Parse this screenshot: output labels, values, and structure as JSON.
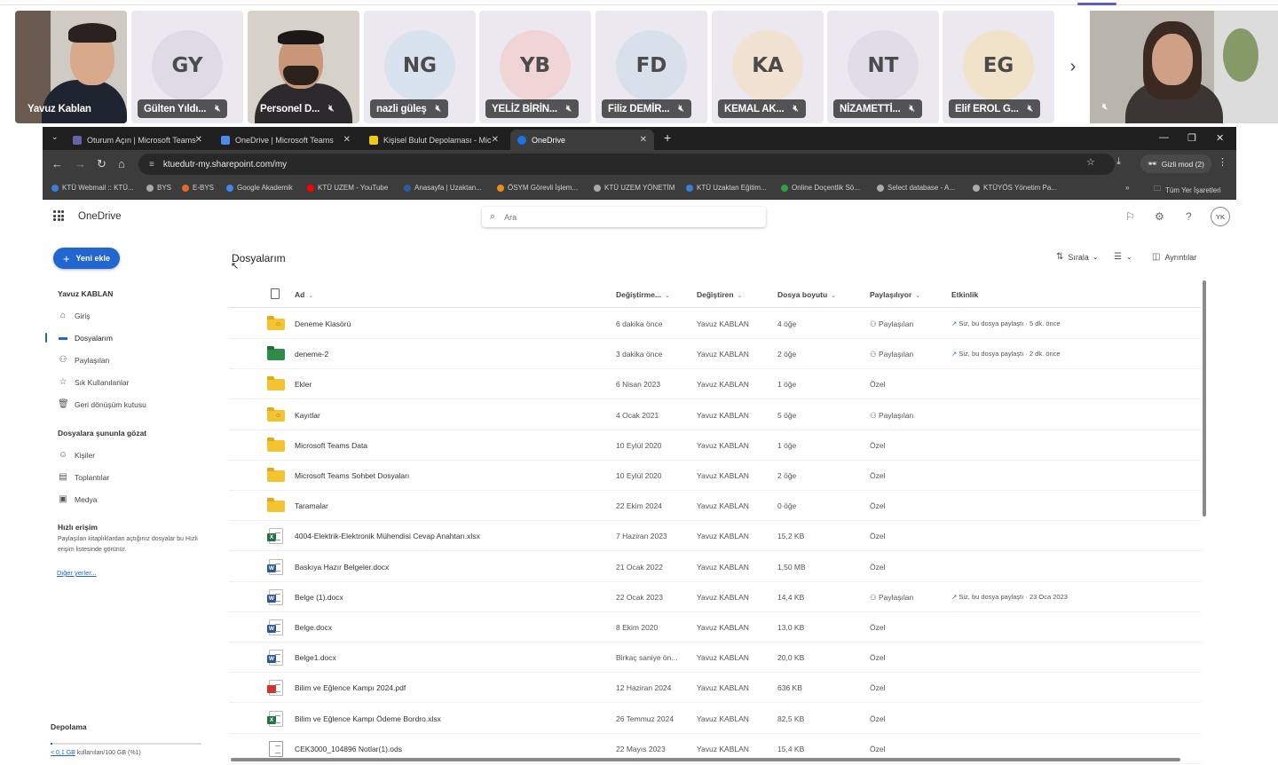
{
  "meeting": {
    "participants": [
      {
        "name": "Yavuz Kablan",
        "initials": "",
        "avatar_color": "",
        "video": true
      },
      {
        "name": "Gülten Yıldı...",
        "initials": "GY",
        "avatar_color": "#dedbe4",
        "video": false
      },
      {
        "name": "Personel D...",
        "initials": "",
        "avatar_color": "",
        "video": true
      },
      {
        "name": "nazli güleş",
        "initials": "NG",
        "avatar_color": "#d9e2ef",
        "video": false
      },
      {
        "name": "YELİZ BİRİN...",
        "initials": "YB",
        "avatar_color": "#f0d4d6",
        "video": false
      },
      {
        "name": "Filiz DEMİR...",
        "initials": "FD",
        "avatar_color": "#d8e0ec",
        "video": false
      },
      {
        "name": "KEMAL AK...",
        "initials": "KA",
        "avatar_color": "#f1e2d2",
        "video": false
      },
      {
        "name": "NİZAMETTİ...",
        "initials": "NT",
        "avatar_color": "#e0dce8",
        "video": false
      },
      {
        "name": "Elif EROL G...",
        "initials": "EG",
        "avatar_color": "#f1e3c9",
        "video": false
      }
    ],
    "next_icon": "chevron-right-icon",
    "mic_icon": "mic-off-icon"
  },
  "browser": {
    "tabs": [
      {
        "title": "Oturum Açın | Microsoft Teams",
        "favicon_color": "#6264a7",
        "active": false
      },
      {
        "title": "OneDrive | Microsoft Teams",
        "favicon_color": "#4b8be8",
        "active": false
      },
      {
        "title": "Kişisel Bulut Depolaması - Mic",
        "favicon_color": "#f2c811",
        "active": false
      },
      {
        "title": "OneDrive",
        "favicon_color": "#1a73e8",
        "active": true
      }
    ],
    "new_tab": "+",
    "window_controls": [
      "—",
      "❐",
      "✕"
    ],
    "url": "ktuedutr-my.sharepoint.com/my",
    "profile_label": "Gizli mod (2)",
    "bookmarks": [
      {
        "label": "KTÜ Webmail :: KTÜ...",
        "color": "#3b7ddd"
      },
      {
        "label": "BYS",
        "color": "#aaaaaa"
      },
      {
        "label": "E-BYS",
        "color": "#e06a2a"
      },
      {
        "label": "Google Akademik",
        "color": "#4285f4"
      },
      {
        "label": "KTÜ UZEM - YouTube",
        "color": "#ff0000"
      },
      {
        "label": "Anasayfa | Uzaktan...",
        "color": "#2a5caa"
      },
      {
        "label": "ÖSYM Görevli İşlem...",
        "color": "#f08a1c"
      },
      {
        "label": "KTÜ UZEM YÖNETİM",
        "color": "#aaaaaa"
      },
      {
        "label": "KTÜ Uzaktan Eğitim...",
        "color": "#3b7ddd"
      },
      {
        "label": "Online Doçentlik Sö...",
        "color": "#2ea043"
      },
      {
        "label": "Select database - A...",
        "color": "#aaaaaa"
      },
      {
        "label": "KTÜYÖS Yönetim Pa...",
        "color": "#aaaaaa"
      }
    ],
    "bookmarks_more": "»",
    "all_bookmarks": "Tüm Yer İşaretleri"
  },
  "app": {
    "name": "OneDrive",
    "search_placeholder": "Ara",
    "user_initials": "YK",
    "new_button": "Yeni ekle",
    "user_name": "Yavuz KABLAN",
    "nav": [
      {
        "label": "Giriş",
        "icon": "home-icon",
        "selected": false
      },
      {
        "label": "Dosyalarım",
        "icon": "folder-icon",
        "selected": true
      },
      {
        "label": "Paylaşılan",
        "icon": "people-icon",
        "selected": false
      },
      {
        "label": "Sık Kullanılanlar",
        "icon": "star-icon",
        "selected": false
      },
      {
        "label": "Geri dönüşüm kutusu",
        "icon": "trash-icon",
        "selected": false
      }
    ],
    "browse_heading": "Dosyalara şununla gözat",
    "browse": [
      {
        "label": "Kişiler",
        "icon": "person-icon"
      },
      {
        "label": "Toplantılar",
        "icon": "calendar-icon"
      },
      {
        "label": "Medya",
        "icon": "image-icon"
      }
    ],
    "quick_access_heading": "Hızlı erişim",
    "quick_access_note": "Paylaşılan kitaplıklardan açtığınız dosyalar bu Hızlı erişim listesinde görünür.",
    "more_places": "Diğer yerler...",
    "storage_heading": "Depolama",
    "storage_used": "< 0,1 GB",
    "storage_rest": "kullanılan/100 GB (%1)",
    "storage_fraction": 0.01
  },
  "files": {
    "title": "Dosyalarım",
    "sort_label": "Sırala",
    "details_label": "Ayrıntılar",
    "columns": {
      "name": "Ad",
      "modified": "Değiştirme...",
      "modified_by": "Değiştiren",
      "size": "Dosya boyutu",
      "sharing": "Paylaşılıyor",
      "activity": "Etkinlik"
    },
    "rows": [
      {
        "type": "folder-shared",
        "name": "Deneme Klasörü",
        "modified": "6 dakika önce",
        "by": "Yavuz KABLAN",
        "size": "4 öğe",
        "sharing": "Paylaşılan",
        "activity": "Siz, bu dosya paylaştı · 5 dk. önce"
      },
      {
        "type": "folder-green",
        "name": "deneme-2",
        "modified": "3 dakika önce",
        "by": "Yavuz KABLAN",
        "size": "2 öğe",
        "sharing": "Paylaşılan",
        "activity": "Siz, bu dosya paylaştı · 2 dk. önce"
      },
      {
        "type": "folder",
        "name": "Ekler",
        "modified": "6 Nisan 2023",
        "by": "Yavuz KABLAN",
        "size": "1 öğe",
        "sharing": "Özel",
        "activity": ""
      },
      {
        "type": "folder-shared",
        "name": "Kayıtlar",
        "modified": "4 Ocak 2021",
        "by": "Yavuz KABLAN",
        "size": "5 öğe",
        "sharing": "Paylaşılan",
        "activity": ""
      },
      {
        "type": "folder",
        "name": "Microsoft Teams Data",
        "modified": "10 Eylül 2020",
        "by": "Yavuz KABLAN",
        "size": "1 öğe",
        "sharing": "Özel",
        "activity": ""
      },
      {
        "type": "folder",
        "name": "Microsoft Teams Sohbet Dosyaları",
        "modified": "10 Eylül 2020",
        "by": "Yavuz KABLAN",
        "size": "2 öğe",
        "sharing": "Özel",
        "activity": ""
      },
      {
        "type": "folder",
        "name": "Taramalar",
        "modified": "22 Ekim 2024",
        "by": "Yavuz KABLAN",
        "size": "0 öğe",
        "sharing": "Özel",
        "activity": ""
      },
      {
        "type": "xlsx",
        "name": "4004-Elektrik-Elektronik Mühendisi Cevap Anahtarı.xlsx",
        "modified": "7 Haziran 2023",
        "by": "Yavuz KABLAN",
        "size": "15,2 KB",
        "sharing": "Özel",
        "activity": ""
      },
      {
        "type": "docx",
        "name": "Baskıya Hazır Belgeler.docx",
        "modified": "21 Ocak 2022",
        "by": "Yavuz KABLAN",
        "size": "1,50 MB",
        "sharing": "Özel",
        "activity": ""
      },
      {
        "type": "docx",
        "name": "Belge (1).docx",
        "modified": "22 Ocak 2023",
        "by": "Yavuz KABLAN",
        "size": "14,4 KB",
        "sharing": "Paylaşılan",
        "activity": "Siz, bu dosya paylaştı · 23 Oca 2023"
      },
      {
        "type": "docx",
        "name": "Belge.docx",
        "modified": "8 Ekim 2020",
        "by": "Yavuz KABLAN",
        "size": "13,0 KB",
        "sharing": "Özel",
        "activity": ""
      },
      {
        "type": "docx",
        "name": "Belge1.docx",
        "modified": "Birkaç saniye ön...",
        "by": "Yavuz KABLAN",
        "size": "20,0 KB",
        "sharing": "Özel",
        "activity": ""
      },
      {
        "type": "pdf",
        "name": "Bilim ve Eğlence Kampı 2024.pdf",
        "modified": "12 Haziran 2024",
        "by": "Yavuz KABLAN",
        "size": "636 KB",
        "sharing": "Özel",
        "activity": ""
      },
      {
        "type": "xlsx",
        "name": "Bilim ve Eğlence Kampı Ödeme Bordro.xlsx",
        "modified": "26 Temmuz 2024",
        "by": "Yavuz KABLAN",
        "size": "82,5 KB",
        "sharing": "Özel",
        "activity": ""
      },
      {
        "type": "ods",
        "name": "CEK3000_104896 Notlar(1).ods",
        "modified": "22 Mayıs 2023",
        "by": "Yavuz KABLAN",
        "size": "15,4 KB",
        "sharing": "Özel",
        "activity": ""
      }
    ]
  },
  "colors": {
    "accent": "#2266d1",
    "word": "#2b579a",
    "excel": "#217346",
    "pdf": "#d33333"
  }
}
